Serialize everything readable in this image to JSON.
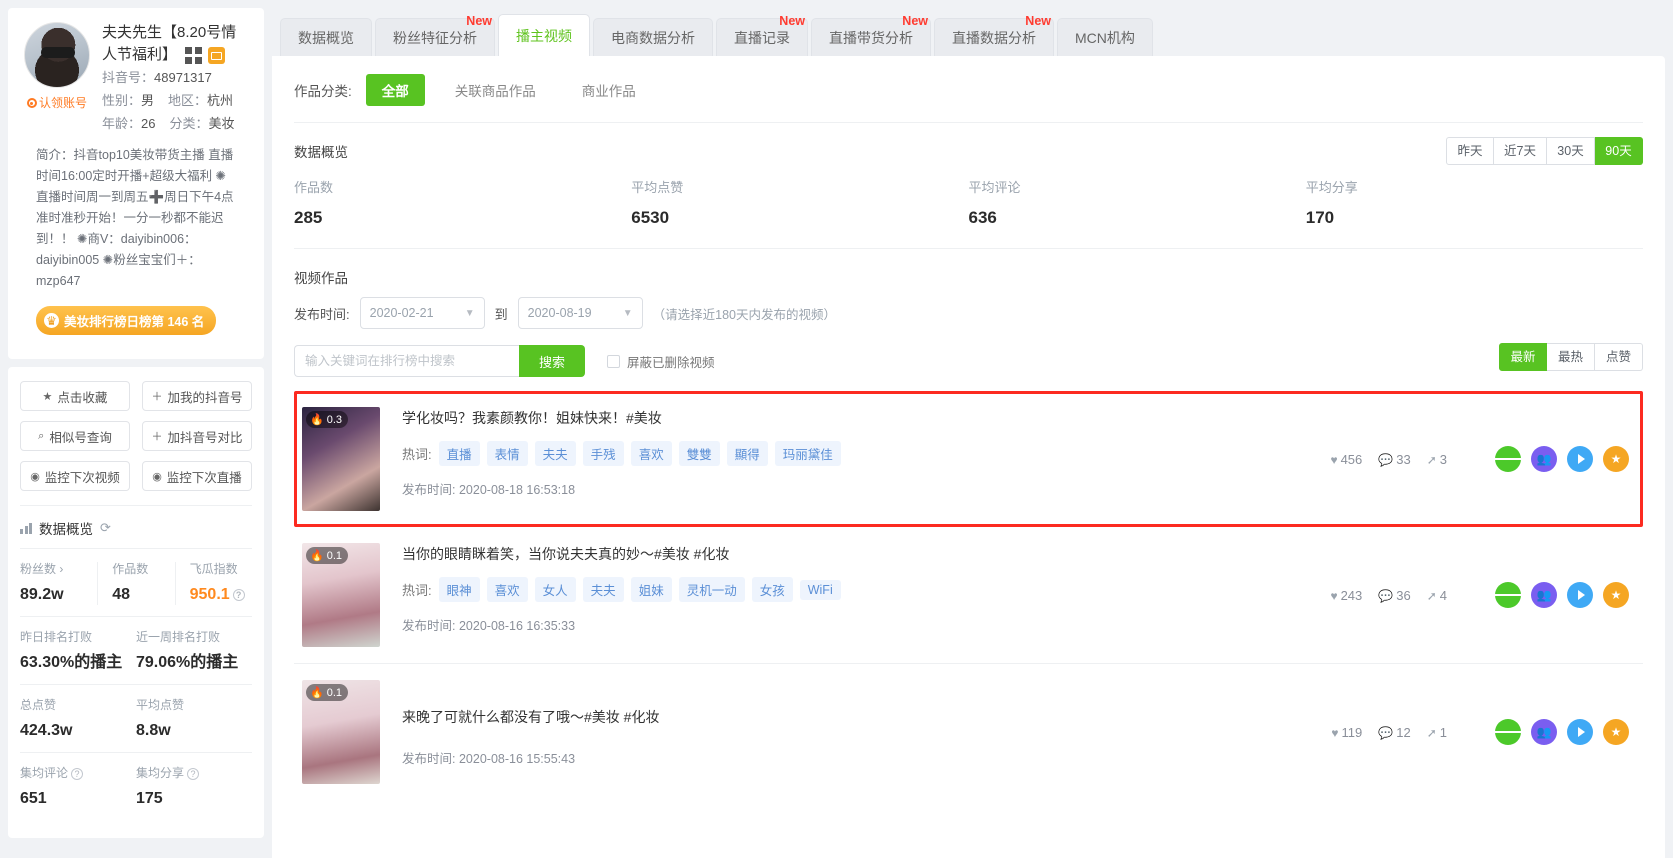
{
  "profile": {
    "nickname": "夫夫先生【8.20号情人节福利】",
    "claim_label": "认领账号",
    "douyin_label": "抖音号：",
    "douyin_id": "48971317",
    "gender_label": "性别：",
    "gender": "男",
    "region_label": "地区：",
    "region": "杭州",
    "age_label": "年龄：",
    "age": "26",
    "category_label": "分类：",
    "category": "美妆",
    "bio_label": "简介：",
    "bio": "抖音top10美妆带货主播 直播时间16:00定时开播+超级大福利 ✺直播时间周一到周五➕周日下午4点准时准秒开始！一分一秒都不能迟到！！ ✺商V：daiyibin006：daiyibin005 ✺粉丝宝宝们＋：mzp647",
    "rank_pill": "美妆排行榜日榜第 146 名"
  },
  "sidebar_buttons": [
    {
      "icon": "star-icon",
      "glyph": "★",
      "label": "点击收藏"
    },
    {
      "icon": "plus-icon",
      "glyph": "＋",
      "label": "加我的抖音号"
    },
    {
      "icon": "search-icon",
      "glyph": "⌕",
      "label": "相似号查询"
    },
    {
      "icon": "plus-icon",
      "glyph": "＋",
      "label": "加抖音号对比"
    },
    {
      "icon": "eye-icon",
      "glyph": "◉",
      "label": "监控下次视频"
    },
    {
      "icon": "eye-icon",
      "glyph": "◉",
      "label": "监控下次直播"
    }
  ],
  "sidebar_stats": {
    "title": "数据概览",
    "refresh_icon": "refresh-icon",
    "rows": [
      [
        {
          "key": "粉丝数 ›",
          "value": "89.2w",
          "orange": false
        },
        {
          "key": "作品数",
          "value": "48",
          "orange": false
        },
        {
          "key": "飞瓜指数",
          "value": "950.1",
          "orange": true,
          "help": true
        }
      ],
      [
        {
          "key": "昨日排名打败",
          "value": "63.30%的播主",
          "orange": false
        },
        {
          "key": "近一周排名打败",
          "value": "79.06%的播主",
          "orange": false
        }
      ],
      [
        {
          "key": "总点赞",
          "value": "424.3w",
          "orange": false
        },
        {
          "key": "平均点赞",
          "value": "8.8w",
          "orange": false
        }
      ],
      [
        {
          "key": "集均评论",
          "value": "651",
          "orange": false,
          "help": true
        },
        {
          "key": "集均分享",
          "value": "175",
          "orange": false,
          "help": true
        }
      ]
    ]
  },
  "tabs": [
    {
      "label": "数据概览",
      "active": false,
      "new": ""
    },
    {
      "label": "粉丝特征分析",
      "active": false,
      "new": "New"
    },
    {
      "label": "播主视频",
      "active": true,
      "new": ""
    },
    {
      "label": "电商数据分析",
      "active": false,
      "new": ""
    },
    {
      "label": "直播记录",
      "active": false,
      "new": "New"
    },
    {
      "label": "直播带货分析",
      "active": false,
      "new": "New"
    },
    {
      "label": "直播数据分析",
      "active": false,
      "new": "New"
    },
    {
      "label": "MCN机构",
      "active": false,
      "new": ""
    }
  ],
  "work_filter": {
    "label": "作品分类:",
    "chips": [
      {
        "label": "全部",
        "active": true
      },
      {
        "label": "关联商品作品",
        "active": false
      },
      {
        "label": "商业作品",
        "active": false
      }
    ]
  },
  "overview": {
    "title": "数据概览",
    "ranges": [
      {
        "label": "昨天",
        "active": false
      },
      {
        "label": "近7天",
        "active": false
      },
      {
        "label": "30天",
        "active": false
      },
      {
        "label": "90天",
        "active": true
      }
    ],
    "cells": [
      {
        "key": "作品数",
        "value": "285"
      },
      {
        "key": "平均点赞",
        "value": "6530"
      },
      {
        "key": "平均评论",
        "value": "636"
      },
      {
        "key": "平均分享",
        "value": "170"
      }
    ]
  },
  "videos_section": {
    "title": "视频作品",
    "publish_time_label": "发布时间:",
    "date_from": "2020-02-21",
    "date_to": "2020-08-19",
    "to_label": "到",
    "range_hint": "（请选择近180天内发布的视频）",
    "search_placeholder": "输入关键词在排行榜中搜索",
    "search_button": "搜索",
    "hide_deleted_label": "屏蔽已删除视频",
    "sorts": [
      {
        "label": "最新",
        "active": true
      },
      {
        "label": "最热",
        "active": false
      },
      {
        "label": "点赞",
        "active": false
      }
    ],
    "keyword_label": "热词:",
    "time_label": "发布时间:"
  },
  "videos": [
    {
      "highlighted": true,
      "thumb_class": "t1",
      "fire_icon": "fire-icon",
      "fire_score": "0.3",
      "title": "学化妆吗？我素颜教你！姐妹快来！#美妆",
      "keywords": [
        "直播",
        "表情",
        "夫夫",
        "手残",
        "喜欢",
        "雙雙",
        "顯得",
        "玛丽黛佳"
      ],
      "publish_time": "2020-08-18 16:53:18",
      "likes": "456",
      "comments": "33",
      "shares": "3"
    },
    {
      "highlighted": false,
      "thumb_class": "t2",
      "fire_icon": "fire-icon",
      "fire_score": "0.1",
      "title": "当你的眼睛眯着笑，当你说夫夫真的妙～#美妆 #化妆",
      "keywords": [
        "眼神",
        "喜欢",
        "女人",
        "夫夫",
        "姐妹",
        "灵机一动",
        "女孩",
        "WiFi"
      ],
      "publish_time": "2020-08-16 16:35:33",
      "likes": "243",
      "comments": "36",
      "shares": "4"
    },
    {
      "highlighted": false,
      "thumb_class": "t3",
      "fire_icon": "fire-icon",
      "fire_score": "0.1",
      "title": "来晚了可就什么都没有了哦～#美妆 #化妆",
      "keywords": [],
      "publish_time": "2020-08-16 15:55:43",
      "likes": "119",
      "comments": "12",
      "shares": "1"
    }
  ],
  "row_actions": [
    {
      "name": "detail-button",
      "color_class": "a-green",
      "icon": "list-icon"
    },
    {
      "name": "audience-button",
      "color_class": "a-purple",
      "icon": "users-icon"
    },
    {
      "name": "play-button",
      "color_class": "a-blue",
      "icon": "play-icon"
    },
    {
      "name": "favorite-button",
      "color_class": "a-orange",
      "icon": "star-icon"
    }
  ],
  "icons": {
    "heart": "♥",
    "comment": "●",
    "share": "➤",
    "star": "★",
    "users": "👥",
    "fire": "🔥"
  }
}
